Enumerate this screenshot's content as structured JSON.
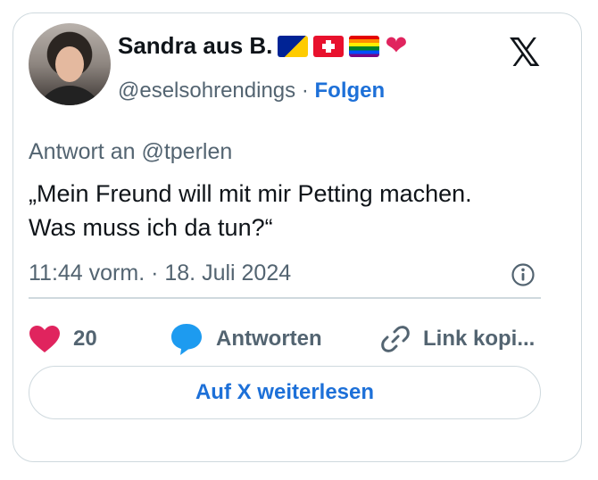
{
  "author": {
    "name": "Sandra aus B.",
    "handle": "@eselsohrendings",
    "separator": "·",
    "follow_label": "Folgen",
    "name_emojis": [
      "flag-bosnia",
      "flag-switzerland",
      "flag-pride",
      "red-heart"
    ]
  },
  "brand": {
    "logo": "x-logo",
    "logo_text": "𝕏"
  },
  "tweet": {
    "reply_to": "Antwort an @tperlen",
    "text_line1": "„Mein Freund will mit mir Petting machen.",
    "text_line2": "Was muss ich da tun?“",
    "timestamp": "11:44 vorm. · 18. Juli 2024"
  },
  "actions": {
    "like_count": "20",
    "reply_label": "Antworten",
    "copy_link_label": "Link kopi..."
  },
  "read_more_label": "Auf X weiterlesen",
  "colors": {
    "accent": "#1d70d8",
    "heart": "#e0245e",
    "reply_bubble": "#1d9bf0",
    "muted": "#536471",
    "border": "#cfd9de"
  }
}
